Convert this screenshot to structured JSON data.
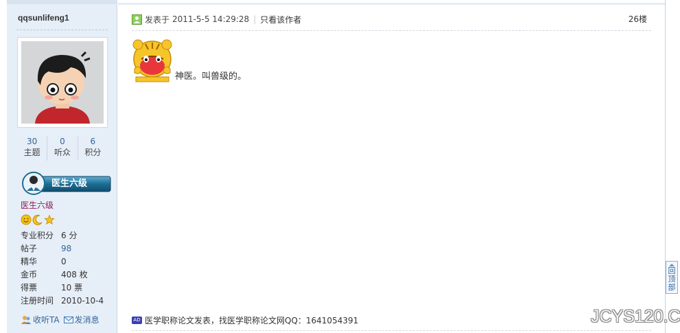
{
  "user": {
    "name": "qqsunlifeng1",
    "stats": [
      {
        "value": "30",
        "label": "主题"
      },
      {
        "value": "0",
        "label": "听众"
      },
      {
        "value": "6",
        "label": "积分"
      }
    ],
    "badge_label": "医生六级",
    "rank_title": "医生六级",
    "rank_icons": [
      "sun-icon",
      "moon-icon",
      "star-icon"
    ],
    "profile": [
      {
        "key": "专业积分",
        "value": "6 分"
      },
      {
        "key": "帖子",
        "value": "98"
      },
      {
        "key": "精华",
        "value": "0"
      },
      {
        "key": "金币",
        "value": "408 枚"
      },
      {
        "key": "得票",
        "value": "10 票"
      },
      {
        "key": "注册时间",
        "value": "2010-10-4"
      }
    ],
    "actions": {
      "follow": "收听TA",
      "message": "发消息"
    }
  },
  "post": {
    "posted_at_prefix": "发表于",
    "posted_at": "2011-5-5 14:29:28",
    "separator": "|",
    "author_only": "只看该作者",
    "floor": "26楼",
    "content_text": "神医。叫兽级的。",
    "ad_tag": "AD",
    "ad_text": "医学职称论文发表，找医学职称论文网QQ：1641054391"
  },
  "back_to_top": "回顶部",
  "watermark": "JCYS120.COM",
  "colors": {
    "sidebar_bg": "#e6eef7",
    "link": "#336699",
    "rank_title": "#8e1a5a",
    "badge_bg": "#1c6d93"
  }
}
